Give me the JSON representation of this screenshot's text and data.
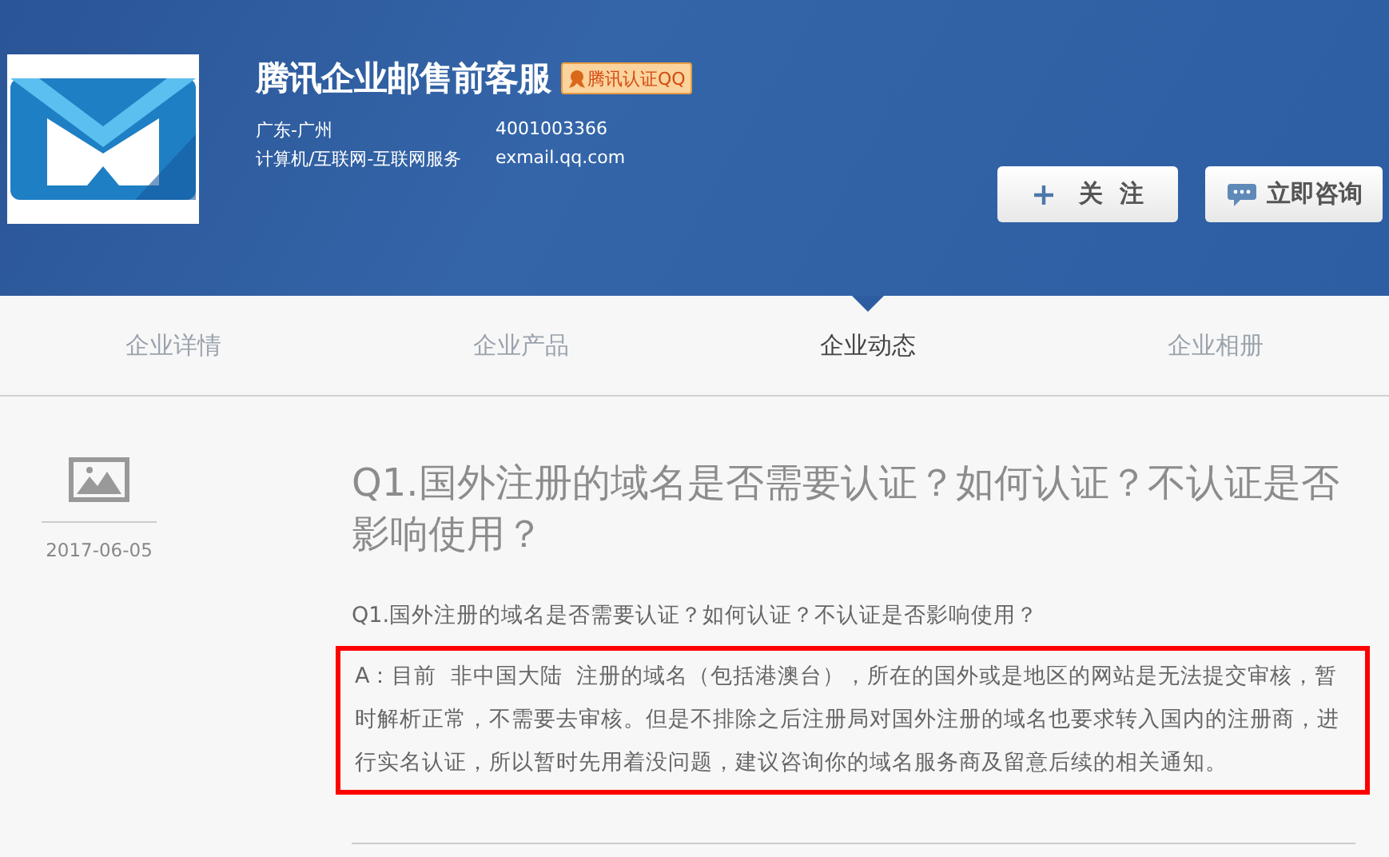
{
  "company": {
    "name": "腾讯企业邮售前客服",
    "badge": "腾讯认证QQ",
    "location": "广东-广州",
    "phone": "4001003366",
    "industry": "计算机/互联网-互联网服务",
    "website": "exmail.qq.com"
  },
  "buttons": [
    {
      "kind": "follow",
      "label": "关  注"
    },
    {
      "kind": "chat",
      "label": "立即咨询"
    }
  ],
  "tabs": [
    {
      "label": "企业详情",
      "selected": false
    },
    {
      "label": "企业产品",
      "selected": false
    },
    {
      "label": "企业动态",
      "selected": true
    },
    {
      "label": "企业相册",
      "selected": false
    }
  ],
  "post": {
    "date": "2017-06-05",
    "title": "Q1.国外注册的域名是否需要认证？如何认证？不认证是否影响使用？",
    "question": "Q1.国外注册的域名是否需要认证？如何认证？不认证是否影响使用？",
    "answer": "A：目前  非中国大陆  注册的域名（包括港澳台），所在的国外或是地区的网站是无法提交审核，暂时解析正常，不需要去审核。但是不排除之后注册局对国外注册的域名也要求转入国内的注册商，进行实名认证，所以暂时先用着没问题，建议咨询你的域名服务商及留意后续的相关通知。",
    "highlighted": true
  }
}
